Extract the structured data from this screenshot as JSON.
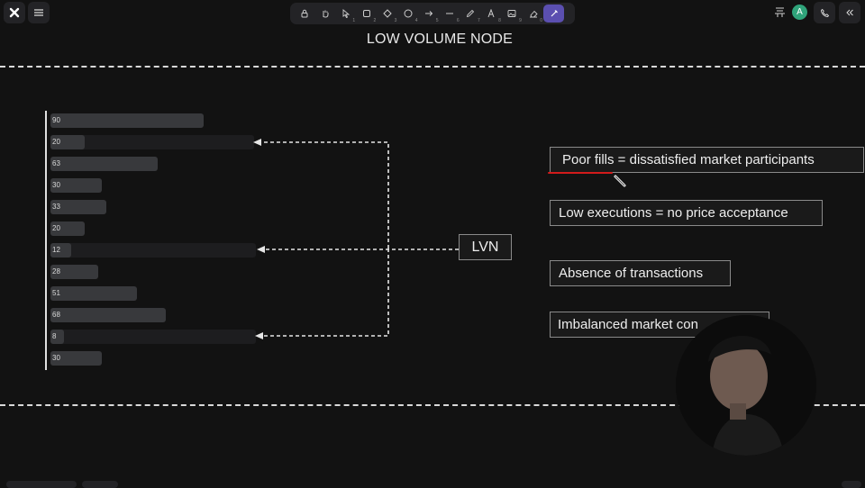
{
  "header": {
    "menu_icon": "hamburger-icon",
    "logo_icon": "excalidraw-logo-icon",
    "tools": [
      {
        "icon": "lock-icon",
        "num": ""
      },
      {
        "icon": "hand-icon",
        "num": ""
      },
      {
        "icon": "select-icon",
        "num": "1"
      },
      {
        "icon": "rectangle-icon",
        "num": "2"
      },
      {
        "icon": "diamond-icon",
        "num": "3"
      },
      {
        "icon": "ellipse-icon",
        "num": "4"
      },
      {
        "icon": "arrow-icon",
        "num": "5"
      },
      {
        "icon": "line-icon",
        "num": "6"
      },
      {
        "icon": "pencil-icon",
        "num": "7"
      },
      {
        "icon": "text-icon",
        "num": "8"
      },
      {
        "icon": "image-icon",
        "num": "9"
      },
      {
        "icon": "eraser-icon",
        "num": "0"
      },
      {
        "icon": "laser-icon",
        "num": "",
        "active": true
      }
    ],
    "avatar_letter": "A",
    "right_icons": [
      "library-icon",
      "phone-icon",
      "collapse-icon"
    ]
  },
  "canvas": {
    "title": "LOW VOLUME NODE",
    "lvn_label": "LVN",
    "bars": [
      {
        "label": "90",
        "value": 90
      },
      {
        "label": "20",
        "value": 20
      },
      {
        "label": "63",
        "value": 63
      },
      {
        "label": "30",
        "value": 30
      },
      {
        "label": "33",
        "value": 33
      },
      {
        "label": "20",
        "value": 20
      },
      {
        "label": "12",
        "value": 12
      },
      {
        "label": "28",
        "value": 28
      },
      {
        "label": "51",
        "value": 51
      },
      {
        "label": "68",
        "value": 68
      },
      {
        "label": "8",
        "value": 8
      },
      {
        "label": "30",
        "value": 30
      }
    ],
    "notes": [
      "Poor fills = dissatisfied market participants",
      "Low executions = no price acceptance",
      "Absence of transactions",
      "Imbalanced market con"
    ],
    "colors": {
      "background": "#121212",
      "bar": "#38393c",
      "underline": "#d21b1b",
      "active_tool": "#5b4fb0",
      "avatar": "#2fa37a"
    }
  }
}
